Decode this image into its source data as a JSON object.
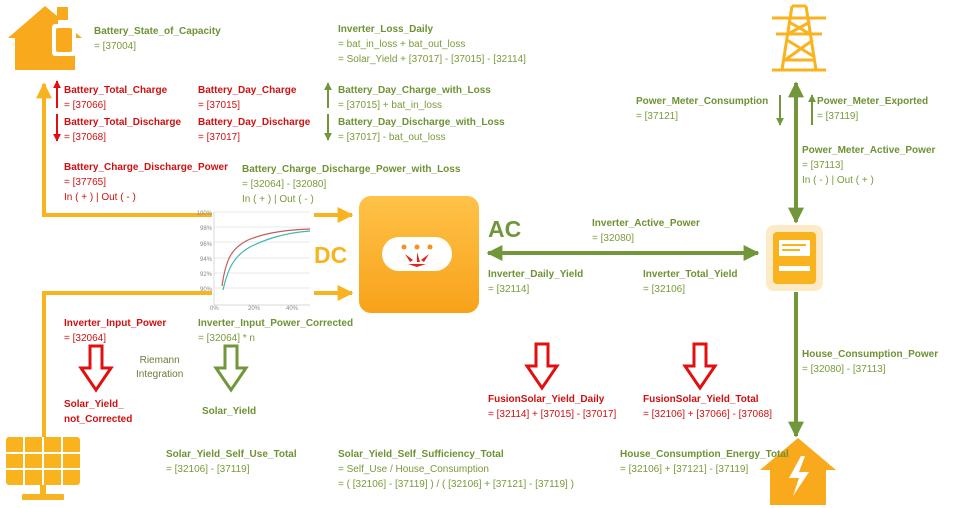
{
  "colors": {
    "orange": "#f9b31f",
    "green": "#72963a",
    "red": "#e01010",
    "text_green": "#7a9a3a",
    "text_red": "#d01010"
  },
  "battery": {
    "state_of_capacity": {
      "title": "Battery_State_of_Capacity",
      "formula": "= [37004]"
    },
    "total_charge": {
      "title": "Battery_Total_Charge",
      "formula": "= [37066]"
    },
    "total_discharge": {
      "title": "Battery_Total_Discharge",
      "formula": "= [37068]"
    },
    "day_charge": {
      "title": "Battery_Day_Charge",
      "formula": "= [37015]"
    },
    "day_discharge": {
      "title": "Battery_Day_Discharge",
      "formula": "= [37017]"
    },
    "day_charge_loss": {
      "title": "Battery_Day_Charge_with_Loss",
      "formula": "= [37015] + bat_in_loss"
    },
    "day_discharge_loss": {
      "title": "Battery_Day_Discharge_with_Loss",
      "formula": "= [37017] - bat_out_loss"
    },
    "cd_power": {
      "title": "Battery_Charge_Discharge_Power",
      "formula": "= [37765]",
      "note": "In ( + ) | Out ( - )"
    },
    "cd_power_loss": {
      "title": "Battery_Charge_Discharge_Power_with_Loss",
      "formula": "= [32064] - [32080]",
      "note": "In ( + ) | Out ( - )"
    }
  },
  "inverter": {
    "loss_daily": {
      "title": "Inverter_Loss_Daily",
      "line1": "= bat_in_loss + bat_out_loss",
      "line2": "= Solar_Yield + [37017] - [37015] - [32114]"
    },
    "active_power": {
      "title": "Inverter_Active_Power",
      "formula": "= [32080]"
    },
    "daily_yield": {
      "title": "Inverter_Daily_Yield",
      "formula": "= [32114]"
    },
    "total_yield": {
      "title": "Inverter_Total_Yield",
      "formula": "= [32106]"
    },
    "input_power": {
      "title": "Inverter_Input_Power",
      "formula": "= [32064]"
    },
    "input_power_corrected": {
      "title": "Inverter_Input_Power_Corrected",
      "formula": "= [32064] * n"
    }
  },
  "labels": {
    "dc": "DC",
    "ac": "AC",
    "riemann_line1": "Riemann",
    "riemann_line2": "Integration"
  },
  "solar": {
    "yield_not_corrected_1": "Solar_Yield_",
    "yield_not_corrected_2": "not_Corrected",
    "yield": "Solar_Yield",
    "self_use_total": {
      "title": "Solar_Yield_Self_Use_Total",
      "formula": "= [32106] - [37119]"
    },
    "self_sufficiency_total": {
      "title": "Solar_Yield_Self_Sufficiency_Total",
      "line1": "= Self_Use / House_Consumption",
      "line2": "= ( [32106] - [37119] ) / ( [32106] + [37121] - [37119] )"
    }
  },
  "fusion": {
    "daily": {
      "title": "FusionSolar_Yield_Daily",
      "formula": "= [32114] + [37015] - [37017]"
    },
    "total": {
      "title": "FusionSolar_Yield_Total",
      "formula": "= [32106] + [37066] - [37068]"
    }
  },
  "meter": {
    "consumption": {
      "title": "Power_Meter_Consumption",
      "formula": "= [37121]"
    },
    "exported": {
      "title": "Power_Meter_Exported",
      "formula": "= [37119]"
    },
    "active_power": {
      "title": "Power_Meter_Active_Power",
      "formula": "= [37113]",
      "note": "In ( - ) | Out ( + )"
    }
  },
  "house": {
    "consumption_power": {
      "title": "House_Consumption_Power",
      "formula": "= [32080] - [37113]"
    },
    "consumption_energy_total": {
      "title": "House_Consumption_Energy_Total",
      "formula": "= [32106] + [37121] - [37119]"
    }
  },
  "efficiency_chart": {
    "y_ticks": [
      "100%",
      "98%",
      "96%",
      "94%",
      "92%",
      "90%"
    ],
    "x_ticks": [
      "0%",
      "20%",
      "40%"
    ]
  }
}
